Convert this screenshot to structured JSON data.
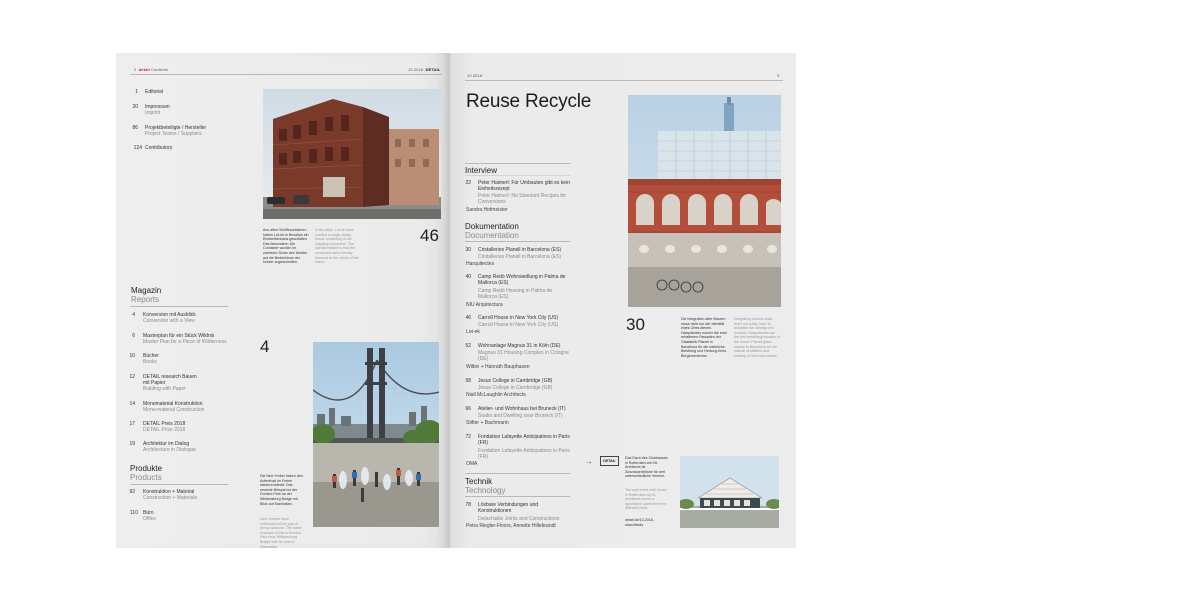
{
  "left_page": {
    "header": {
      "page_num": "2",
      "label": "detail",
      "section": "Contents",
      "issue": "10.2018",
      "brand": "DETAIL"
    },
    "toc_top": [
      {
        "num": "1",
        "de": "Editorial",
        "en": ""
      },
      {
        "num": "20",
        "de": "Impressum",
        "en": "Imprint"
      },
      {
        "num": "86",
        "de": "Projektbeteiligte / Hersteller",
        "en": "Project Teams / Suppliers"
      },
      {
        "num": "124",
        "de": "Contributors",
        "en": ""
      }
    ],
    "magazin": {
      "title_de": "Magazin",
      "title_en": "Reports",
      "items": [
        {
          "num": "4",
          "de": "Konversion mit Ausblick",
          "en": "Conversion with a View"
        },
        {
          "num": "6",
          "de": "Masterplan für ein Stück Wildnis",
          "en": "Master Plan for a Piece of Wilderness"
        },
        {
          "num": "10",
          "de": "Bücher",
          "en": "Books"
        },
        {
          "num": "12",
          "de": "DETAIL research Bauen mit Papier",
          "en": "Building with Paper"
        },
        {
          "num": "14",
          "de": "Monomaterial Konstruktion",
          "en": "Mono-material Construction"
        },
        {
          "num": "17",
          "de": "DETAIL Preis 2018",
          "en": "DETAIL Prize 2018"
        },
        {
          "num": "19",
          "de": "Architektur im Dialog",
          "en": "Architecture in Dialogue"
        }
      ]
    },
    "produkte": {
      "title_de": "Produkte",
      "title_en": "Products",
      "items": [
        {
          "num": "92",
          "de": "Konstruktion + Material",
          "en": "Construction + Materials"
        },
        {
          "num": "110",
          "de": "Büro",
          "en": "Office"
        }
      ]
    },
    "feature_top": {
      "number": "46",
      "caption_de": "Aus alten Schiffscontainern haben Lot-ek in Brooklyn ein Einfamilienhaus geschaffen. Das Besondere: Die Container wurden im wahrsten Sinne des Wortes auf die Bedürfnisse der Nutzer zugeschnitten.",
      "caption_en": "In Brooklyn, Lot-ek have created a single-family house consisting of old shipping containers. The special feature is that the containers were literally trimmed to the needs of the users."
    },
    "feature_bottom": {
      "number": "4",
      "caption_de": "Die New Yorker haben den Aufenthalt im Freien wiederentdeckt. Das neueste Beispiel ist der Domino Park an der Williamsburg Bridge mit Blick auf Manhattan.",
      "caption_en": "New Yorkers have rediscovered the joys of being outdoors. The latest example of this is Domino Park near Williamsburg Bridge with its view to Manhattan."
    }
  },
  "right_page": {
    "header": {
      "issue": "10.2018",
      "page_num": "3"
    },
    "title": "Reuse Recycle",
    "interview": {
      "title_de": "Interview",
      "items": [
        {
          "num": "22",
          "de": "Peter Haimerl: Für Umbauten gibt es kein Einheitsrezept",
          "en": "Peter Haimerl: No Standard Recipes for Conversions",
          "author": "Sandra Hofmeister"
        }
      ]
    },
    "dokumentation": {
      "title_de": "Dokumentation",
      "title_en": "Documentation",
      "items": [
        {
          "num": "30",
          "de": "Cristalleries Planell in Barcelona (ES)",
          "en": "Cristalleries Planell in Barcelona (ES)",
          "author": "Harquitectes"
        },
        {
          "num": "40",
          "de": "Camp Redó Wohnsiedlung in Palma de Mallorca (ES)",
          "en": "Camp Redó Housing in Palma de Mallorca (ES)",
          "author": "NIU Arquitectura"
        },
        {
          "num": "46",
          "de": "Carroll House in New York City (US)",
          "en": "Carroll House in New York City (US)",
          "author": "Lot-ek"
        },
        {
          "num": "52",
          "de": "Wohnanlage Magnus 31 in Köln (DE)",
          "en": "Magnus 31 Housing Complex in Cologne (DE)",
          "author": "Wilkin + Hanrath Bauphasen"
        },
        {
          "num": "58",
          "de": "Jesus College in Cambridge (GB)",
          "en": "Jesus College in Cambridge (GB)",
          "author": "Niall McLaughlin Architects"
        },
        {
          "num": "66",
          "de": "Atelier- und Wohnhaus bei Bruneck (IT)",
          "en": "Studio and Dwelling near Bruneck (IT)",
          "author": "Stifter + Bachmann"
        },
        {
          "num": "72",
          "de": "Fondation Lafayette Anticipations in Paris (FR)",
          "en": "Fondation Lafayette Anticipations in Paris (FR)",
          "author": "OMA"
        }
      ]
    },
    "technik": {
      "title_de": "Technik",
      "title_en": "Technology",
      "items": [
        {
          "num": "78",
          "de": "Lösbare Verbindungen und Konstruktionen",
          "en": "Detachable Joints and Constructions",
          "author": "Petra Riegler-Floors, Annette Hillebrandt"
        }
      ]
    },
    "feature_top": {
      "number": "30",
      "caption_de": "Die Integration alter Mauern muss nicht nur der Identität eines Ortes dienen. Harquitectes nutzen die zwei erhaltenen Fassaden der Glasfabrik Planell in Barcelona für die natürliche Belüftung und Heizung ihres Bürgerzentrums.",
      "caption_en": "Integrating historic walls does not solely have to establish the identity of a location. Harquitectes use the two remaining facades of the former Planell glass factory in Barcelona for the natural ventilation and heating of their civic centre."
    },
    "online": {
      "logo": "DETAIL",
      "caption_de": "Das Dach des Clubhauses in Rotterdam von NL Architects ist Zuschauertribüne für drei unterschiedliche Vereine.",
      "caption_en": "The roof of the club house in Rotterdam by NL Architects forms a spectators' stand for three different clubs.",
      "link": "detail.de/10-2018-nlarchitects"
    }
  }
}
